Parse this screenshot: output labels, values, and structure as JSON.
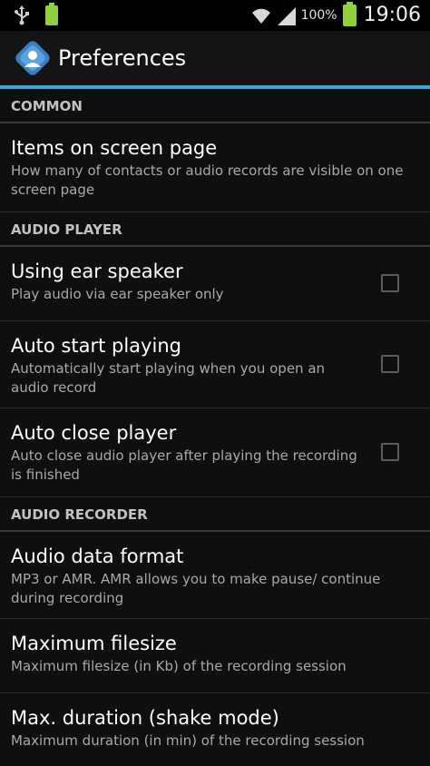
{
  "status_bar": {
    "battery_percent": "100%",
    "time": "19:06"
  },
  "action_bar": {
    "title": "Preferences",
    "app_icon": "app-logo-icon"
  },
  "colors": {
    "accent": "#36a7d8",
    "battery": "#8ed13c"
  },
  "categories": {
    "common": "COMMON",
    "audio_player": "AUDIO PLAYER",
    "audio_recorder": "AUDIO RECORDER"
  },
  "prefs": {
    "items_on_screen": {
      "title": "Items on screen page",
      "summary": "How many of contacts or audio records are visible on one screen page"
    },
    "ear_speaker": {
      "title": "Using ear speaker",
      "summary": "Play audio via ear speaker only",
      "checked": false
    },
    "auto_start": {
      "title": "Auto start playing",
      "summary": "Automatically start playing when you open an audio record",
      "checked": false
    },
    "auto_close": {
      "title": "Auto close player",
      "summary": "Auto close audio player after playing the recording is finished",
      "checked": false
    },
    "data_format": {
      "title": "Audio data format",
      "summary": "MP3 or AMR. AMR allows you to make pause/ continue during recording"
    },
    "max_filesize": {
      "title": "Maximum filesize",
      "summary": "Maximum filesize (in Kb) of the recording session"
    },
    "max_duration": {
      "title": "Max. duration (shake mode)",
      "summary": "Maximum duration (in min) of the recording session"
    }
  }
}
